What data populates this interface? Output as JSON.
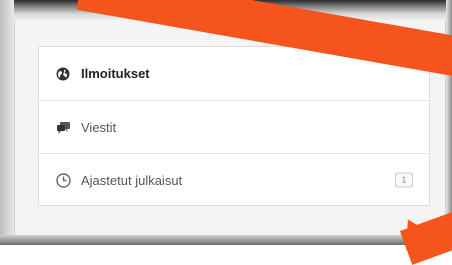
{
  "nav": {
    "items": [
      {
        "label": "Ilmoitukset",
        "icon": "globe-icon",
        "active": true
      },
      {
        "label": "Viestit",
        "icon": "chat-bubbles-icon",
        "active": false
      },
      {
        "label": "Ajastetut julkaisut",
        "icon": "clock-icon",
        "active": false,
        "badge": "1"
      }
    ]
  },
  "colors": {
    "arrow": "#f5541d",
    "panel_border": "#dddddd",
    "text_active": "#222222",
    "text": "#555555"
  }
}
